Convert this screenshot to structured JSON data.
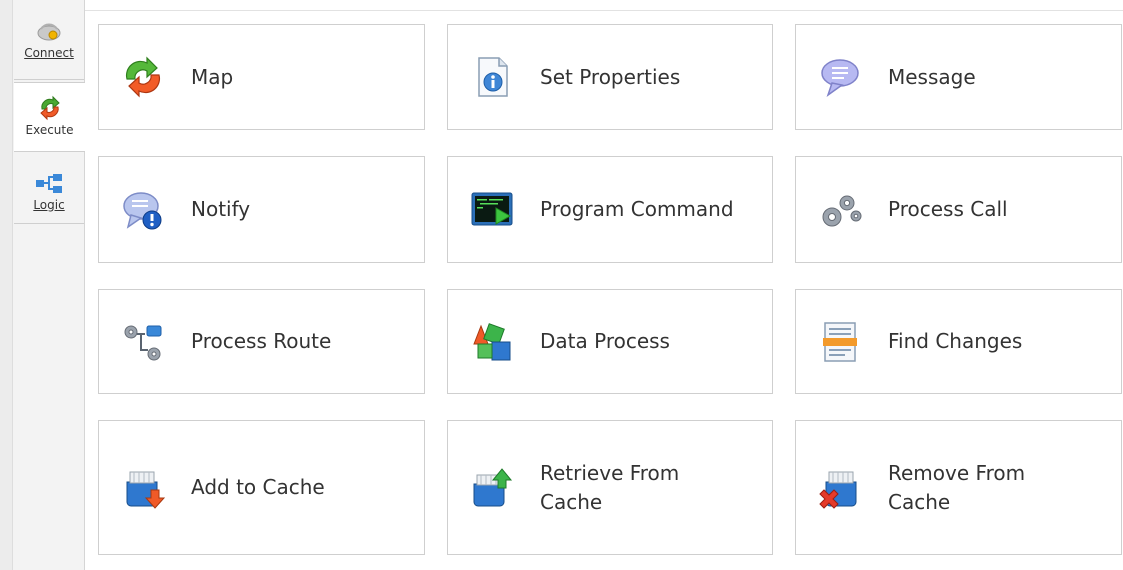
{
  "sidebar": {
    "tabs": [
      {
        "label": "Connect",
        "icon": "connect-icon"
      },
      {
        "label": "Execute",
        "icon": "execute-icon",
        "selected": true
      },
      {
        "label": "Logic",
        "icon": "logic-icon"
      }
    ]
  },
  "grid": {
    "items": [
      {
        "label": "Map",
        "icon": "map-icon"
      },
      {
        "label": "Set Properties",
        "icon": "set-properties-icon"
      },
      {
        "label": "Message",
        "icon": "message-icon"
      },
      {
        "label": "Notify",
        "icon": "notify-icon"
      },
      {
        "label": "Program Command",
        "icon": "program-command-icon"
      },
      {
        "label": "Process Call",
        "icon": "process-call-icon"
      },
      {
        "label": "Process Route",
        "icon": "process-route-icon"
      },
      {
        "label": "Data Process",
        "icon": "data-process-icon"
      },
      {
        "label": "Find Changes",
        "icon": "find-changes-icon"
      },
      {
        "label": "Add to Cache",
        "icon": "add-to-cache-icon"
      },
      {
        "label": "Retrieve From Cache",
        "icon": "retrieve-from-cache-icon"
      },
      {
        "label": "Remove From Cache",
        "icon": "remove-from-cache-icon"
      }
    ]
  }
}
